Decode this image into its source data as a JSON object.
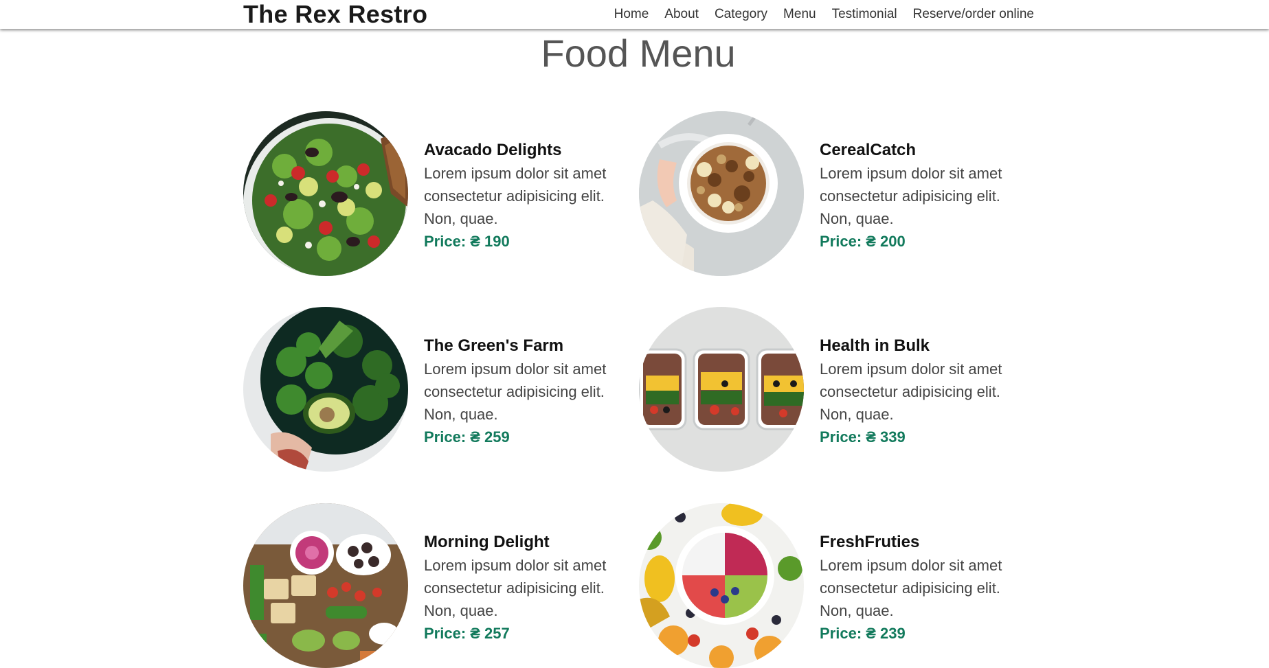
{
  "header": {
    "brand": "The Rex Restro",
    "nav": [
      "Home",
      "About",
      "Category",
      "Menu",
      "Testimonial",
      "Reserve/order online"
    ]
  },
  "menu": {
    "title": "Food Menu",
    "items": [
      {
        "name": "Avacado Delights",
        "description": "Lorem ipsum dolor sit amet consectetur adipisicing elit. Non, quae.",
        "price": "Price: ₴ 190",
        "image": "avocado-salad-bowl"
      },
      {
        "name": "CerealCatch",
        "description": "Lorem ipsum dolor sit amet consectetur adipisicing elit. Non, quae.",
        "price": "Price: ₴ 200",
        "image": "granola-banana-bowl"
      },
      {
        "name": "The Green's Farm",
        "description": "Lorem ipsum dolor sit amet consectetur adipisicing elit. Non, quae.",
        "price": "Price: ₴ 259",
        "image": "green-vegetables-bowl"
      },
      {
        "name": "Health in Bulk",
        "description": "Lorem ipsum dolor sit amet consectetur adipisicing elit. Non, quae.",
        "price": "Price: ₴ 339",
        "image": "meal-prep-containers"
      },
      {
        "name": "Morning Delight",
        "description": "Lorem ipsum dolor sit amet consectetur adipisicing elit. Non, quae.",
        "price": "Price: ₴ 257",
        "image": "snack-platter"
      },
      {
        "name": "FreshFruties",
        "description": "Lorem ipsum dolor sit amet consectetur adipisicing elit. Non, quae.",
        "price": "Price: ₴ 239",
        "image": "fruit-smoothie-bowl"
      }
    ]
  },
  "colors": {
    "price": "#127a5c",
    "brand_text": "#1a1a1a",
    "title_text": "#555555"
  }
}
